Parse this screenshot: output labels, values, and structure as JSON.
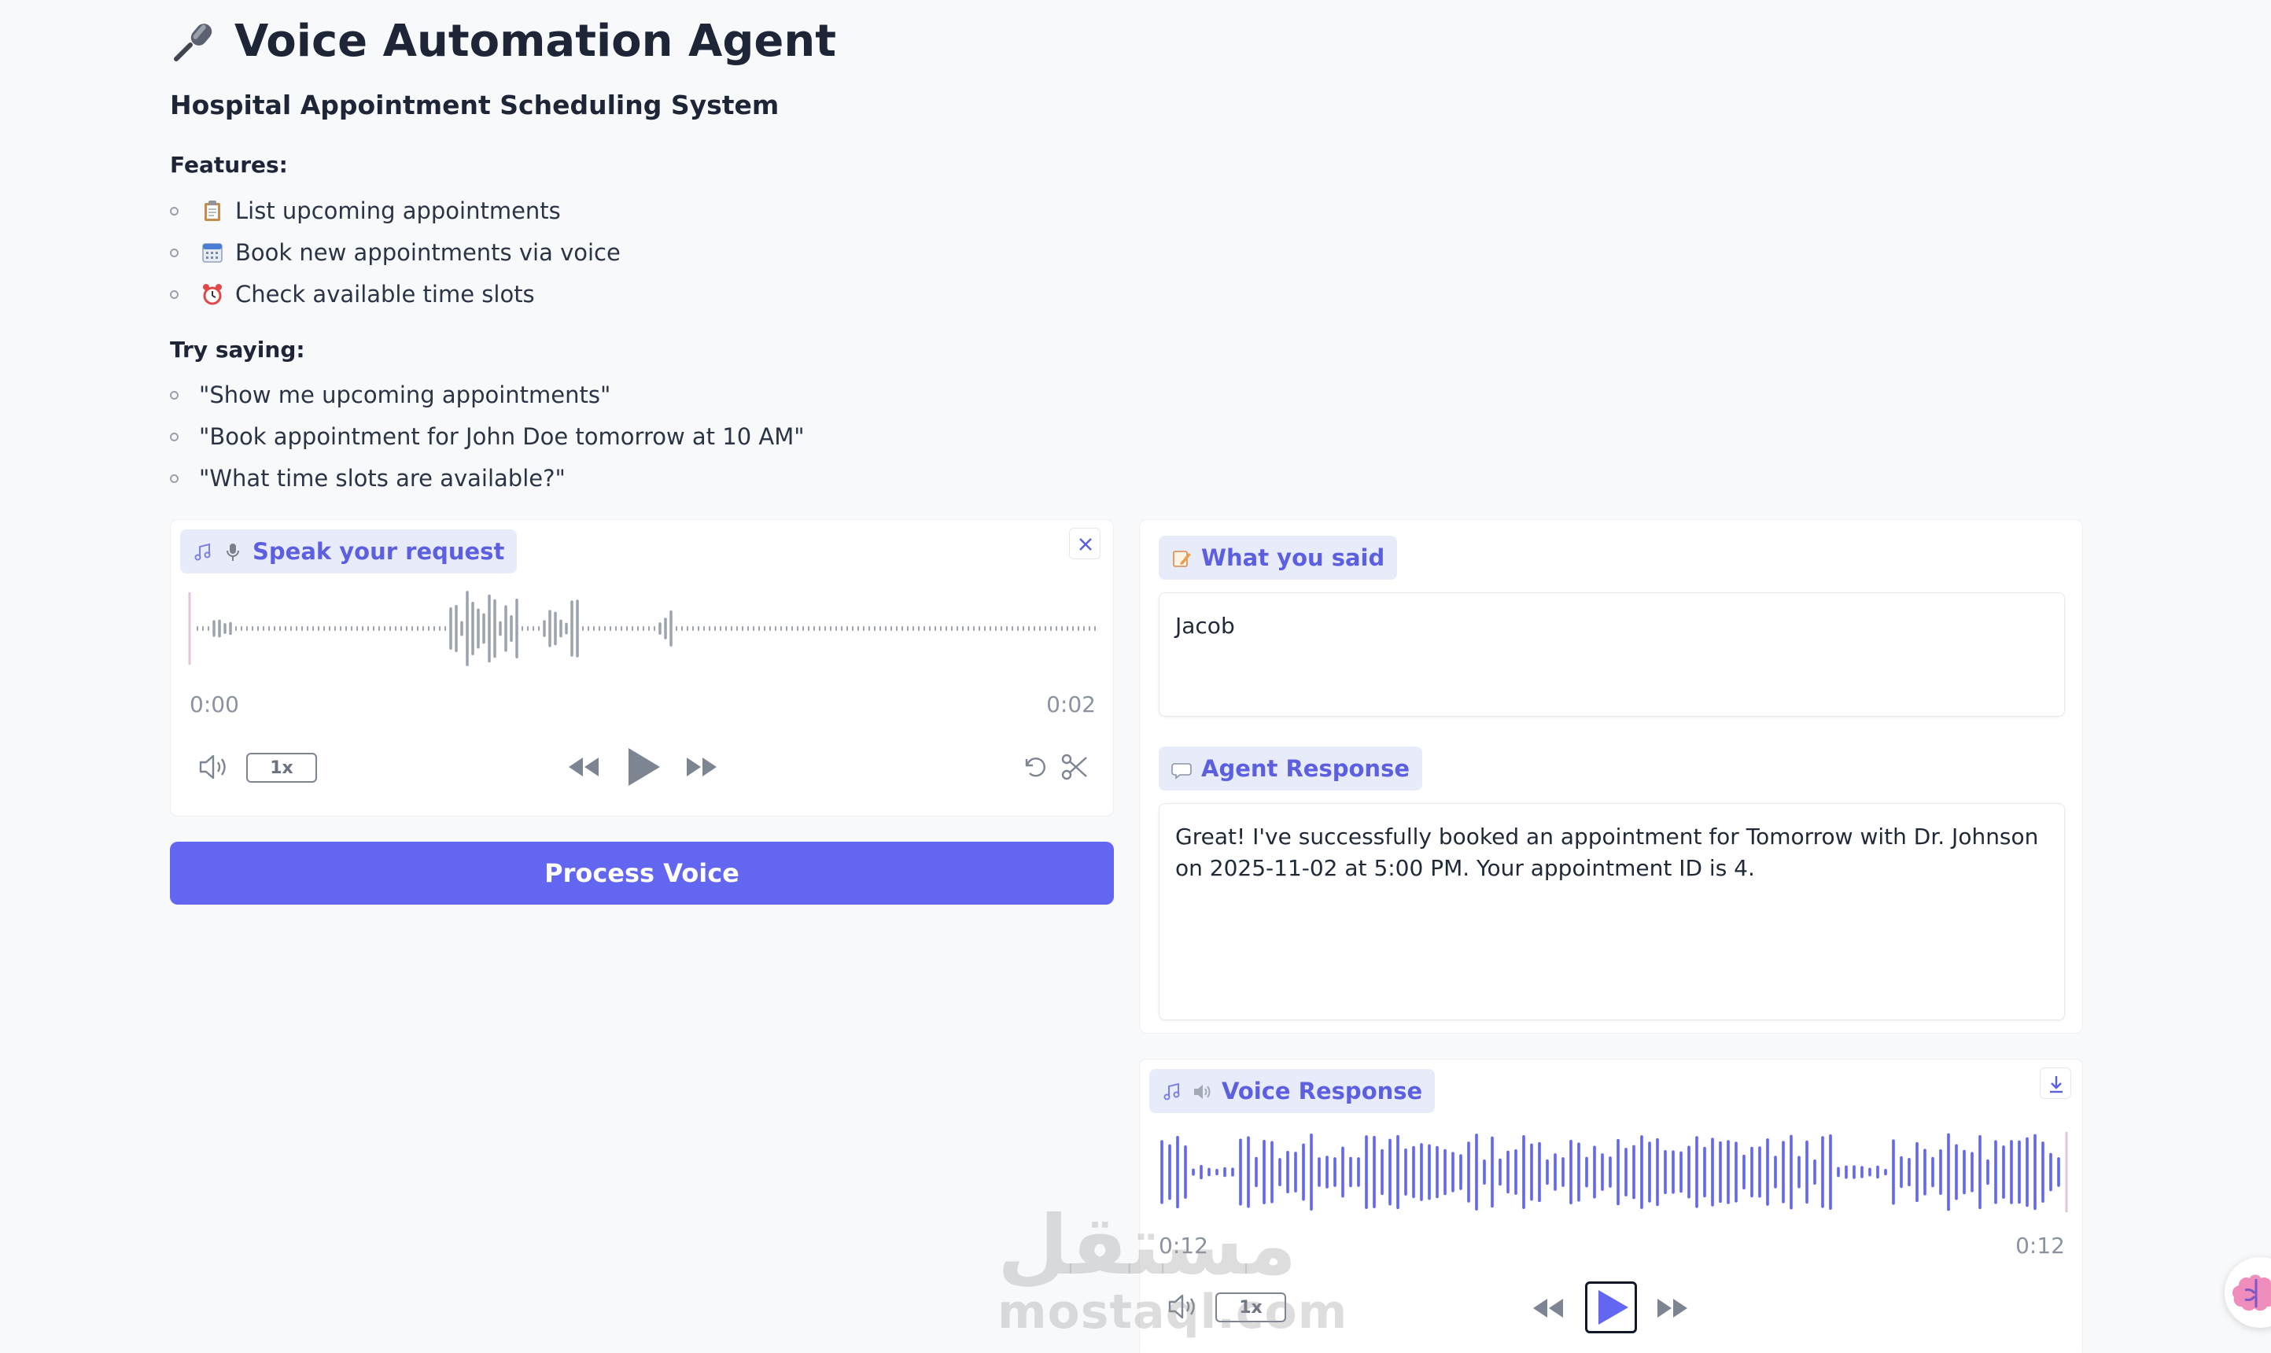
{
  "header": {
    "title": "Voice Automation Agent",
    "subtitle": "Hospital Appointment Scheduling System"
  },
  "features": {
    "label": "Features:",
    "items": [
      {
        "icon": "clipboard-icon",
        "text": "List upcoming appointments"
      },
      {
        "icon": "calendar-icon",
        "text": "Book new appointments via voice"
      },
      {
        "icon": "alarm-clock-icon",
        "text": "Check available time slots"
      }
    ]
  },
  "try_saying": {
    "label": "Try saying:",
    "items": [
      "\"Show me upcoming appointments\"",
      "\"Book appointment for John Doe tomorrow at 10 AM\"",
      "\"What time slots are available?\""
    ]
  },
  "input_audio": {
    "label": "Speak your request",
    "time_start": "0:00",
    "time_end": "0:02",
    "speed": "1x"
  },
  "process_button": "Process Voice",
  "transcript": {
    "label": "What you said",
    "text": "Jacob"
  },
  "agent_response": {
    "label": "Agent Response",
    "text": "Great! I've successfully booked an appointment for Tomorrow with Dr. Johnson on 2025-11-02 at 5:00 PM. Your appointment ID is 4."
  },
  "voice_response": {
    "label": "Voice Response",
    "time_start": "0:12",
    "time_end": "0:12",
    "speed": "1x"
  },
  "watermark": {
    "arabic": "مستقل",
    "latin": "mostaql.com"
  },
  "colors": {
    "accent": "#6366f1",
    "pill_bg": "#e8ebfa",
    "waveform_gray": "#9ca3af",
    "waveform_accent": "#6366f1"
  }
}
